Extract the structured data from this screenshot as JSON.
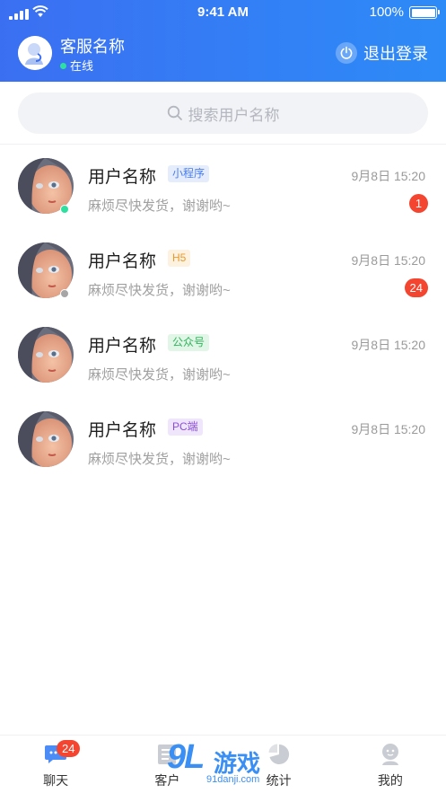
{
  "status_bar": {
    "time": "9:41 AM",
    "battery": "100%"
  },
  "header": {
    "agent_name": "客服名称",
    "agent_status": "在线",
    "logout_label": "退出登录",
    "gradient": [
      "#3b6ff2",
      "#2d8bf7"
    ]
  },
  "search": {
    "placeholder": "搜索用户名称"
  },
  "conversations": [
    {
      "name": "用户名称",
      "tag": "小程序",
      "tag_color": "#4a7df0",
      "tag_bg": "#e5edfd",
      "time": "9月8日 15:20",
      "message": "麻烦尽快发货，谢谢哟~",
      "unread": "1",
      "presence": "#2de0a0"
    },
    {
      "name": "用户名称",
      "tag": "H5",
      "tag_color": "#e89a2c",
      "tag_bg": "#fdf1df",
      "time": "9月8日 15:20",
      "message": "麻烦尽快发货，谢谢哟~",
      "unread": "24",
      "presence": "#a6a6a6"
    },
    {
      "name": "用户名称",
      "tag": "公众号",
      "tag_color": "#2fb35a",
      "tag_bg": "#e2f6e8",
      "time": "9月8日 15:20",
      "message": "麻烦尽快发货，谢谢哟~",
      "unread": "",
      "presence": ""
    },
    {
      "name": "用户名称",
      "tag": "PC端",
      "tag_color": "#8a4fd8",
      "tag_bg": "#f0e6fb",
      "time": "9月8日 15:20",
      "message": "麻烦尽快发货，谢谢哟~",
      "unread": "",
      "presence": ""
    }
  ],
  "tabbar": {
    "items": [
      {
        "label": "聊天",
        "icon": "chat-icon",
        "badge": "24",
        "active": true
      },
      {
        "label": "客户",
        "icon": "customer-icon",
        "badge": ""
      },
      {
        "label": "统计",
        "icon": "stats-icon",
        "badge": ""
      },
      {
        "label": "我的",
        "icon": "profile-icon",
        "badge": ""
      }
    ]
  },
  "watermark": {
    "big": "9L",
    "text": "游戏",
    "url": "91danji.com"
  }
}
